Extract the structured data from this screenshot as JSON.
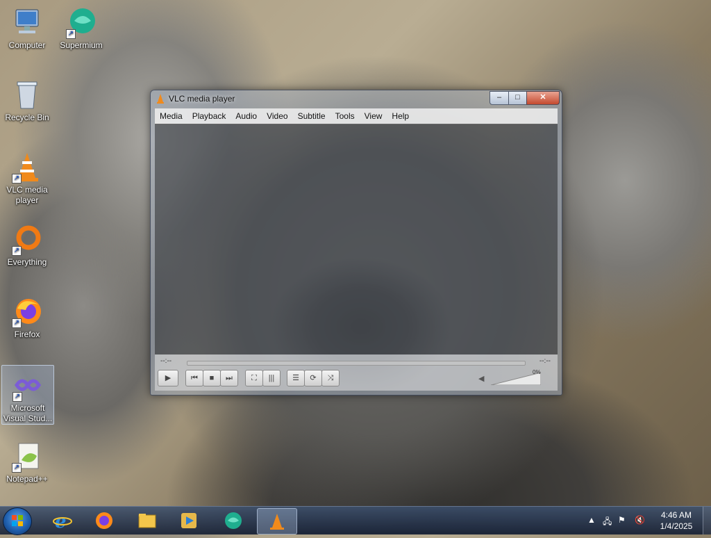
{
  "desktop": {
    "icons": [
      {
        "label": "Computer"
      },
      {
        "label": "Supermium"
      },
      {
        "label": "Recycle Bin"
      },
      {
        "label": "VLC media player"
      },
      {
        "label": "Everything"
      },
      {
        "label": "Firefox"
      },
      {
        "label": "Microsoft Visual Stud..."
      },
      {
        "label": "Notepad++"
      }
    ]
  },
  "vlc": {
    "title": "VLC media player",
    "menu": [
      "Media",
      "Playback",
      "Audio",
      "Video",
      "Subtitle",
      "Tools",
      "View",
      "Help"
    ],
    "time_elapsed": "--:--",
    "time_total": "--:--",
    "volume_percent": "0%",
    "window_buttons": {
      "minimize": "–",
      "maximize": "□",
      "close": "✕"
    }
  },
  "taskbar": {
    "pinned": [
      "Internet Explorer",
      "Firefox",
      "Windows Explorer",
      "Windows Media Player",
      "Supermium",
      "VLC media player"
    ],
    "tray_time": "4:46 AM",
    "tray_date": "1/4/2025"
  },
  "colors": {
    "taskbar": "#1c2a40",
    "vlc_orange": "#f08a1c",
    "close_red": "#c44a2f"
  }
}
